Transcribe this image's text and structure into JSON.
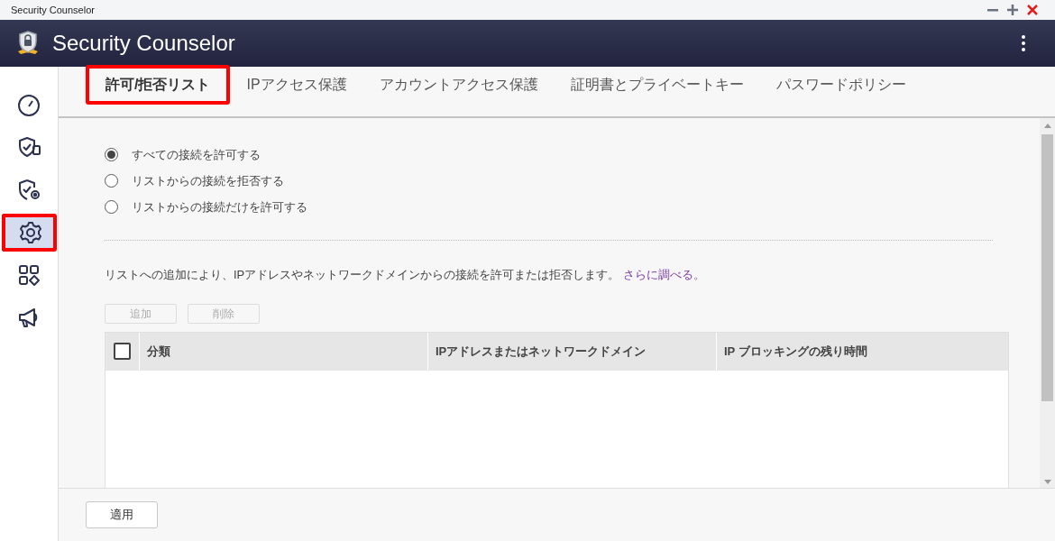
{
  "title_bar": {
    "title": "Security Counselor"
  },
  "app_header": {
    "title": "Security Counselor"
  },
  "sidebar": {
    "items": [
      {
        "kind": "gauge",
        "selected": false,
        "highlighted": false
      },
      {
        "kind": "shield-card",
        "selected": false,
        "highlighted": false
      },
      {
        "kind": "shield-gear",
        "selected": false,
        "highlighted": false
      },
      {
        "kind": "gear",
        "selected": true,
        "highlighted": true
      },
      {
        "kind": "apps",
        "selected": false,
        "highlighted": false
      },
      {
        "kind": "megaphone",
        "selected": false,
        "highlighted": false
      }
    ]
  },
  "tabs": [
    {
      "label": "許可/拒否リスト",
      "selected": true,
      "highlighted": true
    },
    {
      "label": "IPアクセス保護",
      "selected": false,
      "highlighted": false
    },
    {
      "label": "アカウントアクセス保護",
      "selected": false,
      "highlighted": false
    },
    {
      "label": "証明書とプライベートキー",
      "selected": false,
      "highlighted": false
    },
    {
      "label": "パスワードポリシー",
      "selected": false,
      "highlighted": false
    }
  ],
  "radio_options": [
    {
      "label": "すべての接続を許可する",
      "selected": true
    },
    {
      "label": "リストからの接続を拒否する",
      "selected": false
    },
    {
      "label": "リストからの接続だけを許可する",
      "selected": false
    }
  ],
  "description": {
    "text": "リストへの追加により、IPアドレスやネットワークドメインからの接続を許可または拒否します。",
    "link": "さらに調べる。"
  },
  "buttons": [
    {
      "label": "追加",
      "disabled": true
    },
    {
      "label": "削除",
      "disabled": true
    }
  ],
  "table": {
    "select_all_checked": false,
    "columns": [
      "分類",
      "IPアドレスまたはネットワークドメイン",
      "IP ブロッキングの残り時間"
    ]
  },
  "apply_button": {
    "label": "適用"
  }
}
